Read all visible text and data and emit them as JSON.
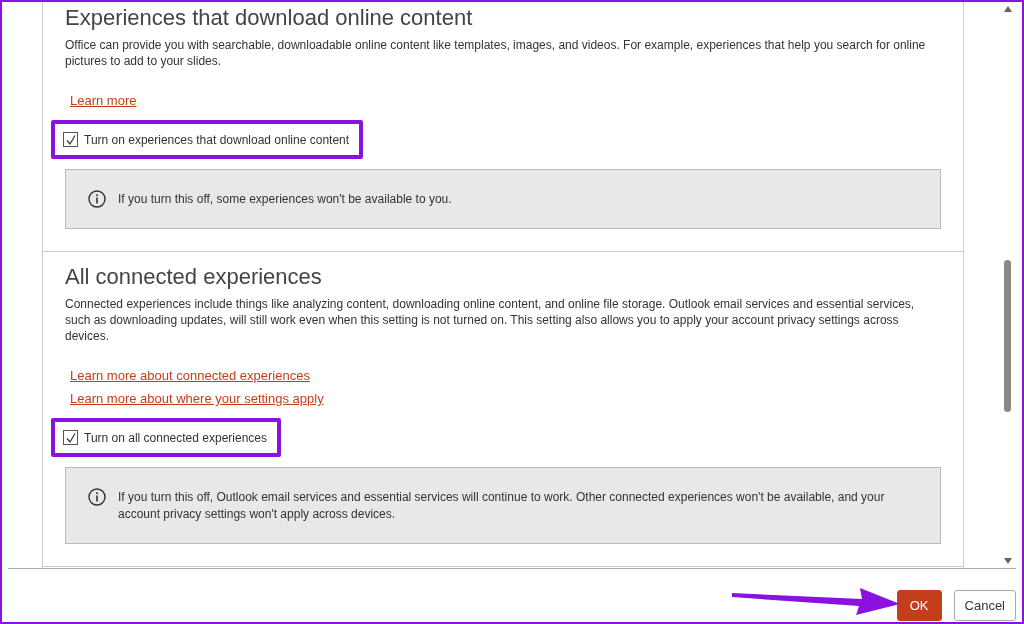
{
  "sections": [
    {
      "heading": "Experiences that download online content",
      "description": "Office can provide you with searchable, downloadable online content like templates, images, and videos. For example, experiences that help you search for online pictures to add to your slides.",
      "links": [
        "Learn more"
      ],
      "checkbox": {
        "label": "Turn on experiences that download online content",
        "checked": true,
        "highlighted": true
      },
      "info": "If you turn this off, some experiences won't be available to you."
    },
    {
      "heading": "All connected experiences",
      "description": "Connected experiences include things like analyzing content, downloading online content, and online file storage. Outlook email services and essential services, such as downloading updates, will still work even when this setting is not turned on. This setting also allows you to apply your account privacy settings across devices.",
      "links": [
        "Learn more about connected experiences",
        "Learn more about where your settings apply"
      ],
      "checkbox": {
        "label": "Turn on all connected experiences",
        "checked": true,
        "highlighted": true
      },
      "info": "If you turn this off, Outlook email services and essential services will continue to work. Other connected experiences won't be available, and your account privacy settings won't apply across devices."
    }
  ],
  "buttons": [
    {
      "label": "OK",
      "kind": "primary",
      "highlighted": true
    },
    {
      "label": "Cancel",
      "kind": "secondary",
      "highlighted": false
    }
  ]
}
